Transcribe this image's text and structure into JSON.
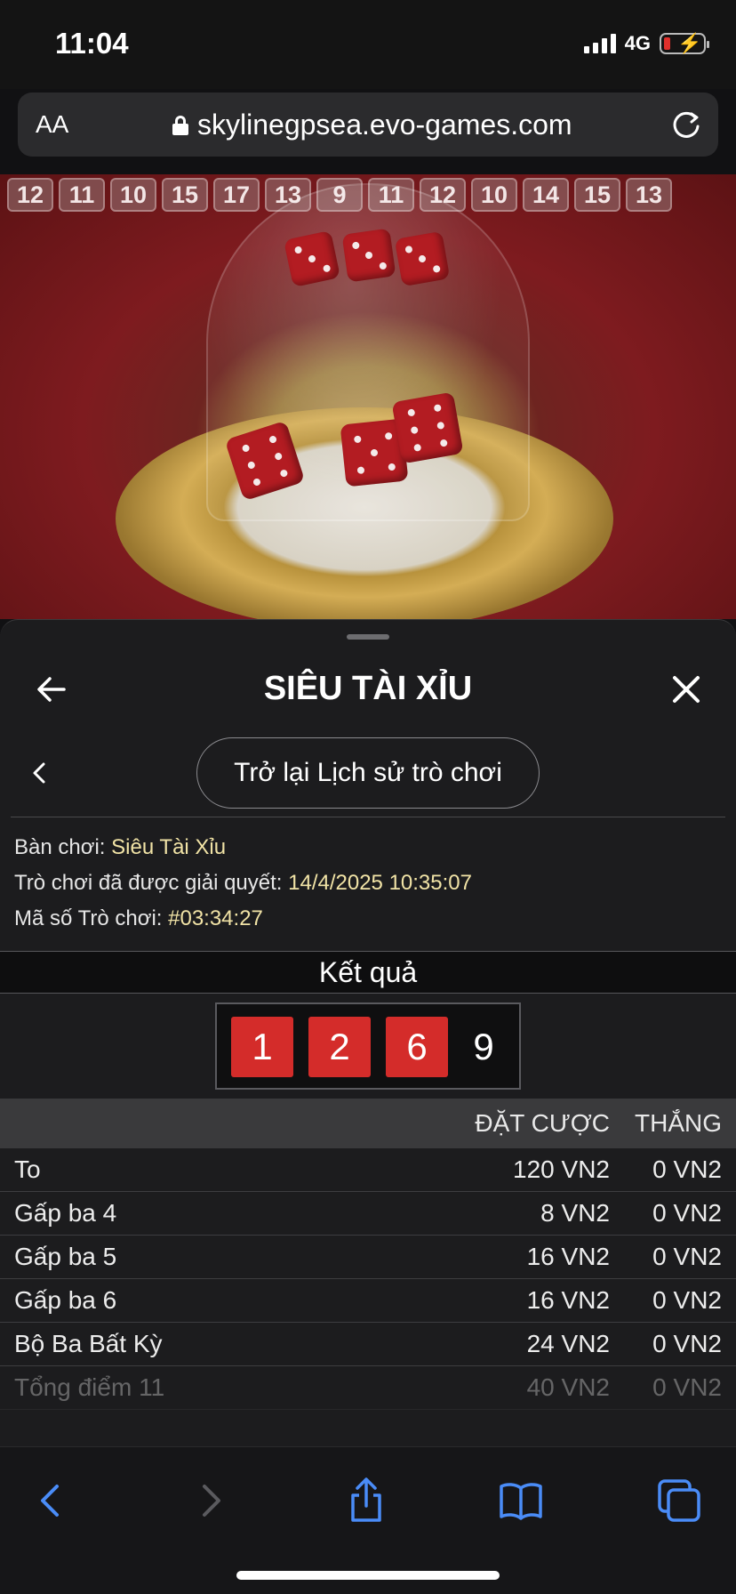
{
  "status_bar": {
    "time": "11:04",
    "network": "4G"
  },
  "browser": {
    "text_size": "AA",
    "url": "skylinegpsea.evo-games.com"
  },
  "game_history": [
    "12",
    "11",
    "10",
    "15",
    "17",
    "13",
    "9",
    "11",
    "12",
    "10",
    "14",
    "15",
    "13"
  ],
  "panel": {
    "title": "SIÊU TÀI XỈU",
    "back_history_label": "Trở lại Lịch sử trò chơi",
    "info": {
      "table_label": "Bàn chơi:",
      "table_value": "Siêu Tài Xỉu",
      "settled_label": "Trò chơi đã được giải quyết:",
      "settled_value": "14/4/2025 10:35:07",
      "game_id_label": "Mã số Trò chơi:",
      "game_id_value": "#03:34:27"
    },
    "result_heading": "Kết quả",
    "result": {
      "dice": [
        "1",
        "2",
        "6"
      ],
      "total": "9"
    },
    "table": {
      "col_bet": "ĐẶT CƯỢC",
      "col_win": "THẮNG",
      "rows": [
        {
          "name": "To",
          "bet": "120 VN2",
          "win": "0 VN2"
        },
        {
          "name": "Gấp ba 4",
          "bet": "8 VN2",
          "win": "0 VN2"
        },
        {
          "name": "Gấp ba 5",
          "bet": "16 VN2",
          "win": "0 VN2"
        },
        {
          "name": "Gấp ba 6",
          "bet": "16 VN2",
          "win": "0 VN2"
        },
        {
          "name": "Bộ Ba Bất Kỳ",
          "bet": "24 VN2",
          "win": "0 VN2"
        },
        {
          "name": "Tổng điểm 11",
          "bet": "40 VN2",
          "win": "0 VN2"
        }
      ]
    }
  },
  "colors": {
    "accent_value": "#f1e3a6",
    "die_red": "#d42c2a",
    "browser_blue": "#4a8cf7"
  }
}
